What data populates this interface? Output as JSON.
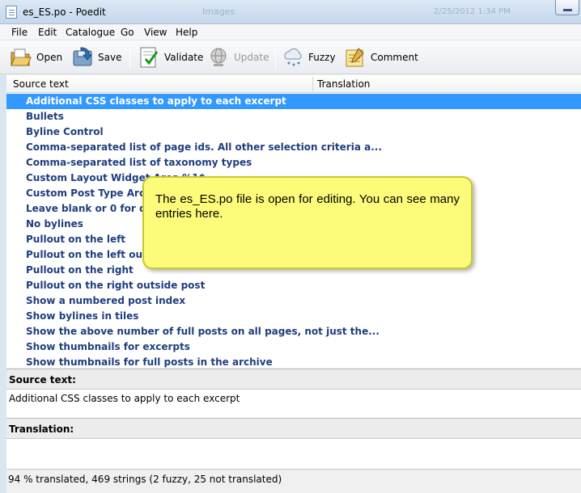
{
  "window": {
    "title": "es_ES.po - Poedit",
    "background_title": "Images",
    "background_timestamp": "2/25/2012 1:34 PM"
  },
  "menu": [
    "File",
    "Edit",
    "Catalogue",
    "Go",
    "View",
    "Help"
  ],
  "toolbar": {
    "open": "Open",
    "save": "Save",
    "validate": "Validate",
    "update": "Update",
    "fuzzy": "Fuzzy",
    "comment": "Comment"
  },
  "list": {
    "col_source": "Source text",
    "col_translation": "Translation",
    "rows": [
      "Additional CSS classes to apply to each excerpt",
      "Bullets",
      "Byline Control",
      "Comma-separated list of page ids. All other selection criteria a...",
      "Comma-separated list of taxonomy types",
      "Custom Layout Widget Area %1$",
      "Custom Post Type Archive",
      "Leave blank or 0 for default",
      "No bylines",
      "Pullout on the left",
      "Pullout on the left outside",
      "Pullout on the right",
      "Pullout on the right outside post",
      "Show a numbered post index",
      "Show bylines in tiles",
      "Show the above number of full posts on all pages, not just the...",
      "Show thumbnails for excerpts",
      "Show thumbnails for full posts in the archive"
    ],
    "selected_index": 0
  },
  "tooltip": {
    "text": "The es_ES.po file is open for editing. You can see many entries here."
  },
  "source_pane": {
    "label": "Source text:",
    "value": "Additional CSS classes to apply to each excerpt"
  },
  "translation_pane": {
    "label": "Translation:",
    "value": ""
  },
  "status": {
    "text": "94 % translated, 469 strings (2 fuzzy, 25 not translated)"
  },
  "colors": {
    "selection": "#3399ff",
    "entry_text": "#1f3e7e",
    "tooltip_bg": "#fcfc7a"
  }
}
